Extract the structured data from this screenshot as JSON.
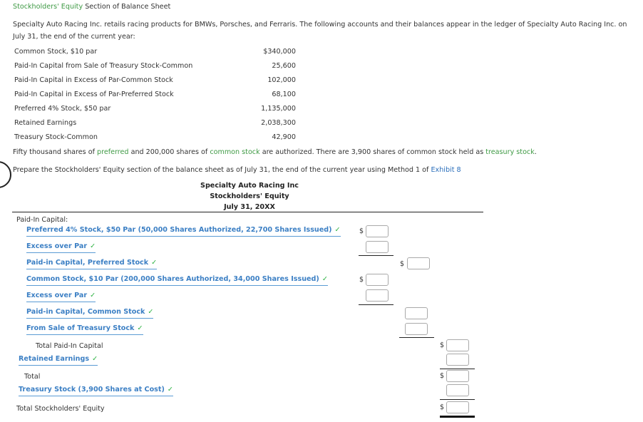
{
  "header": {
    "title_highlight": "Stockholders' Equity",
    "title_rest": " Section of Balance Sheet"
  },
  "intro": "Specialty Auto Racing Inc. retails racing products for BMWs, Porsches, and Ferraris. The following accounts and their balances appear in the ledger of Specialty Auto Racing Inc. on July 31, the end of the current year:",
  "accounts": [
    {
      "name": "Common Stock, $10 par",
      "value": "$340,000"
    },
    {
      "name": "Paid-In Capital from Sale of Treasury Stock-Common",
      "value": "25,600"
    },
    {
      "name": "Paid-In Capital in Excess of Par-Common Stock",
      "value": "102,000"
    },
    {
      "name": "Paid-In Capital in Excess of Par-Preferred Stock",
      "value": "68,100"
    },
    {
      "name": "Preferred 4% Stock, $50 par",
      "value": "1,135,000"
    },
    {
      "name": "Retained Earnings",
      "value": "2,038,300"
    },
    {
      "name": "Treasury Stock-Common",
      "value": "42,900"
    }
  ],
  "note": {
    "p1": "Fifty thousand shares of ",
    "preferred": "preferred",
    "p2": " and 200,000 shares of ",
    "common": "common stock",
    "p3": " are authorized. There are 3,900 shares of common stock held as ",
    "treasury": "treasury stock",
    "p4": "."
  },
  "prepare": {
    "text": "Prepare the Stockholders' Equity section of the balance sheet as of July 31, the end of the current year using Method 1 of ",
    "link": "Exhibit 8"
  },
  "statement": {
    "company": "Specialty Auto Racing Inc",
    "title": "Stockholders' Equity",
    "date": "July 31, 20XX",
    "paid_in_label": "Paid-In Capital:",
    "rows": {
      "pref_stock": "Preferred 4% Stock, $50 Par (50,000 Shares Authorized, 22,700 Shares Issued)",
      "pref_excess": "Excess over Par",
      "pref_paid_in": "Paid-in Capital, Preferred Stock",
      "common_stock": "Common Stock, $10 Par (200,000 Shares Authorized, 34,000 Shares Issued)",
      "common_excess": "Excess over Par",
      "common_paid_in": "Paid-in Capital, Common Stock",
      "treasury_sale": "From Sale of Treasury Stock",
      "total_paid_in": "Total Paid-In Capital",
      "retained": "Retained Earnings",
      "total": "Total",
      "treasury_cost": "Treasury Stock (3,900 Shares at Cost)",
      "total_equity": "Total Stockholders' Equity"
    },
    "check_glyph": "✓",
    "currency": "$",
    "inputs": {
      "pref_stock": "",
      "pref_excess": "",
      "pref_paid_in": "",
      "common_stock": "",
      "common_excess": "",
      "common_paid_in": "",
      "treasury_sale": "",
      "total_paid_in": "",
      "retained": "",
      "total": "",
      "treasury_cost": "",
      "total_equity": ""
    }
  }
}
